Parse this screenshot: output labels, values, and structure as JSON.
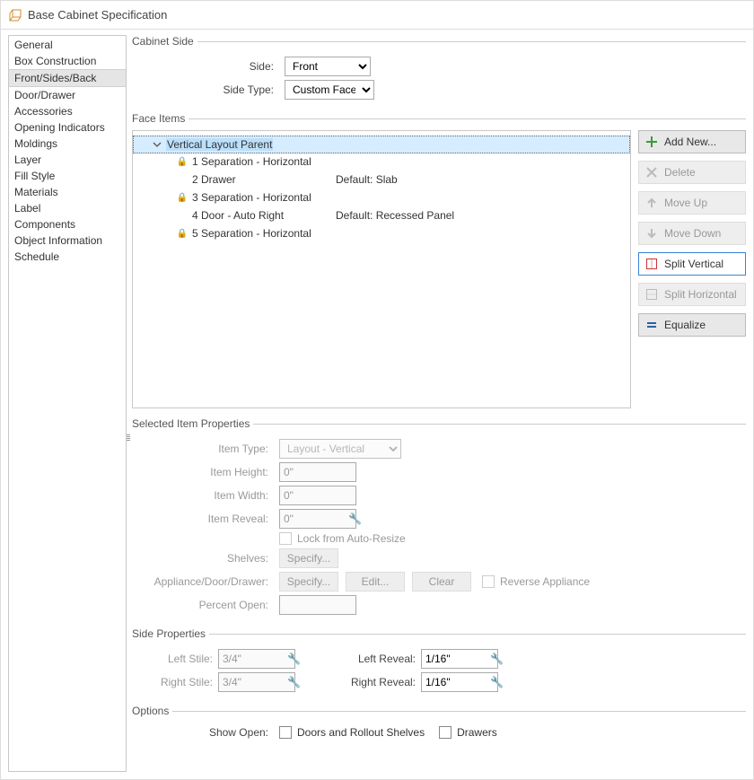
{
  "window": {
    "title": "Base Cabinet Specification"
  },
  "sidebar": {
    "items": [
      "General",
      "Box Construction",
      "Front/Sides/Back",
      "Door/Drawer",
      "Accessories",
      "Opening Indicators",
      "Moldings",
      "Layer",
      "Fill Style",
      "Materials",
      "Label",
      "Components",
      "Object Information",
      "Schedule"
    ],
    "selectedIndex": 2
  },
  "cabinetSide": {
    "legend": "Cabinet Side",
    "sideLabel": "Side:",
    "side": "Front",
    "sideTypeLabel": "Side Type:",
    "sideType": "Custom Face"
  },
  "faceItems": {
    "legend": "Face Items",
    "root": {
      "label": "Vertical Layout Parent"
    },
    "rows": [
      {
        "lock": true,
        "label": "1 Separation - Horizontal",
        "extra": ""
      },
      {
        "lock": false,
        "label": "2 Drawer",
        "extra": "Default: Slab"
      },
      {
        "lock": true,
        "label": "3 Separation - Horizontal",
        "extra": ""
      },
      {
        "lock": false,
        "label": "4 Door - Auto Right",
        "extra": "Default: Recessed Panel"
      },
      {
        "lock": true,
        "label": "5 Separation - Horizontal",
        "extra": ""
      }
    ],
    "actions": {
      "addNew": "Add New...",
      "delete": "Delete",
      "moveUp": "Move Up",
      "moveDown": "Move Down",
      "splitVertical": "Split Vertical",
      "splitHorizontal": "Split Horizontal",
      "equalize": "Equalize"
    }
  },
  "selectedProps": {
    "legend": "Selected Item Properties",
    "itemTypeLabel": "Item Type:",
    "itemType": "Layout - Vertical",
    "itemHeightLabel": "Item Height:",
    "itemHeight": "0\"",
    "itemWidthLabel": "Item Width:",
    "itemWidth": "0\"",
    "itemRevealLabel": "Item Reveal:",
    "itemReveal": "0\"",
    "lockLabel": "Lock from Auto-Resize",
    "shelvesLabel": "Shelves:",
    "shelvesBtn": "Specify...",
    "applianceLabel": "Appliance/Door/Drawer:",
    "specifyBtn": "Specify...",
    "editBtn": "Edit...",
    "clearBtn": "Clear",
    "reverseLabel": "Reverse Appliance",
    "percentOpenLabel": "Percent Open:"
  },
  "sideProps": {
    "legend": "Side Properties",
    "leftStileLabel": "Left Stile:",
    "leftStile": "3/4\"",
    "rightStileLabel": "Right Stile:",
    "rightStile": "3/4\"",
    "leftRevealLabel": "Left Reveal:",
    "leftReveal": "1/16\"",
    "rightRevealLabel": "Right Reveal:",
    "rightReveal": "1/16\""
  },
  "options": {
    "legend": "Options",
    "showOpenLabel": "Show Open:",
    "doorsLabel": "Doors and Rollout Shelves",
    "drawersLabel": "Drawers"
  }
}
